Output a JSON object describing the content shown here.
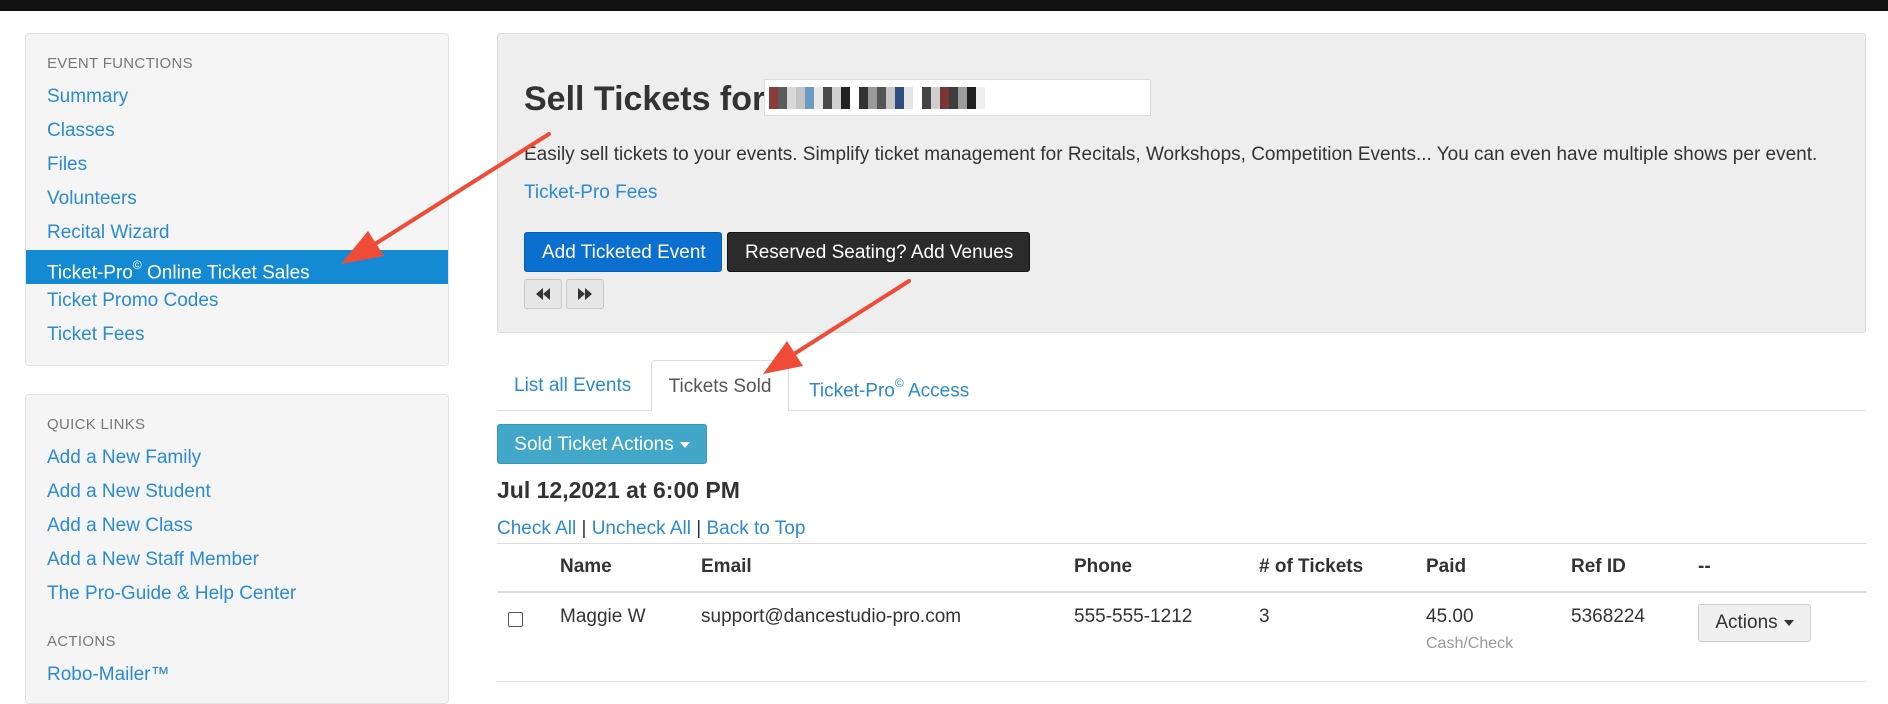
{
  "sidebar": {
    "functions": {
      "heading": "EVENT FUNCTIONS",
      "items": [
        {
          "label": "Summary"
        },
        {
          "label": "Classes"
        },
        {
          "label": "Files"
        },
        {
          "label": "Volunteers"
        },
        {
          "label": "Recital Wizard"
        },
        {
          "label": "Ticket-Pro",
          "sup": "©",
          "suffix": " Online Ticket Sales"
        },
        {
          "label": "Ticket Promo Codes"
        },
        {
          "label": "Ticket Fees"
        }
      ]
    },
    "quick_links": {
      "heading": "QUICK LINKS",
      "items": [
        {
          "label": "Add a New Family"
        },
        {
          "label": "Add a New Student"
        },
        {
          "label": "Add a New Class"
        },
        {
          "label": "Add a New Staff Member"
        },
        {
          "label": "The Pro-Guide & Help Center"
        }
      ]
    },
    "actions": {
      "heading": "ACTIONS",
      "items": [
        {
          "label": "Robo-Mailer™"
        }
      ]
    }
  },
  "header": {
    "title": "Sell Tickets for",
    "description": "Easily sell tickets to your events. Simplify ticket management for Recitals, Workshops, Competition Events... You can even have multiple shows per event.",
    "fees_link": "Ticket-Pro Fees",
    "add_event_button": "Add Ticketed Event",
    "venues_button": "Reserved Seating? Add Venues"
  },
  "tabs": {
    "list_all": "List all Events",
    "tickets_sold": "Tickets Sold",
    "access_label": "Ticket-Pro",
    "access_sup": "©",
    "access_suffix": " Access"
  },
  "sold_actions_label": "Sold Ticket Actions",
  "event_date": "Jul 12,2021 at 6:00 PM",
  "check_links": {
    "check_all": "Check All",
    "uncheck_all": "Uncheck All",
    "back_to_top": "Back to Top",
    "separator": " | "
  },
  "table": {
    "headers": [
      "Name",
      "Email",
      "Phone",
      "# of Tickets",
      "Paid",
      "Ref ID",
      "--"
    ],
    "rows": [
      {
        "name": "Maggie W",
        "email": "support@dancestudio-pro.com",
        "phone": "555-555-1212",
        "tickets": "3",
        "paid": "45.00",
        "payment_method": "Cash/Check",
        "ref_id": "5368224",
        "actions_label": "Actions"
      }
    ]
  },
  "colors": {
    "link": "#2a8ad2",
    "active_nav": "#148ad4",
    "primary_button": "#0a6fcf",
    "dark_button": "#2b2b2b",
    "info_button": "#42a7c8",
    "annotation_arrow": "#f04b36"
  },
  "icons": {
    "prev": "fast-backward-icon",
    "next": "fast-forward-icon"
  }
}
